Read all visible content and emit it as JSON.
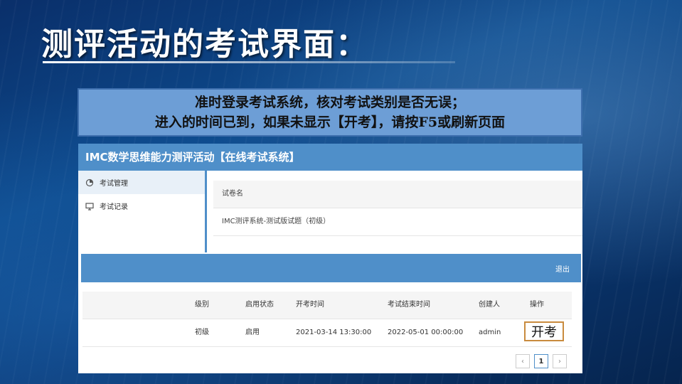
{
  "slide": {
    "title": "测评活动的考试界面："
  },
  "notice": {
    "line1": "准时登录考试系统，核对考试类别是否无误；",
    "line2": "进入的时间已到，如果未显示【开考】，请按F5或刷新页面"
  },
  "app": {
    "header_title": "IMC数学思维能力测评活动【在线考试系统】",
    "sidebar": {
      "items": [
        {
          "label": "考试管理",
          "icon": "pie-chart-icon"
        },
        {
          "label": "考试记录",
          "icon": "monitor-icon"
        }
      ]
    },
    "paper_list": {
      "header": "试卷名",
      "rows": [
        "IMC测评系统-测试版试题（初级）"
      ]
    },
    "toolbar": {
      "logout_label": "退出"
    },
    "exam_table": {
      "columns": [
        "级别",
        "启用状态",
        "开考时间",
        "考试结束时间",
        "创建人",
        "操作"
      ],
      "rows": [
        {
          "level": "初级",
          "status": "启用",
          "start_time": "2021-03-14 13:30:00",
          "end_time": "2022-05-01 00:00:00",
          "creator": "admin",
          "action": "开考"
        }
      ]
    },
    "pagination": {
      "prev": "‹",
      "current": "1",
      "next": "›"
    }
  },
  "colors": {
    "accent": "#4f8fc9",
    "notice_bg": "#6d9ed6",
    "action_border": "#c98b3e"
  }
}
